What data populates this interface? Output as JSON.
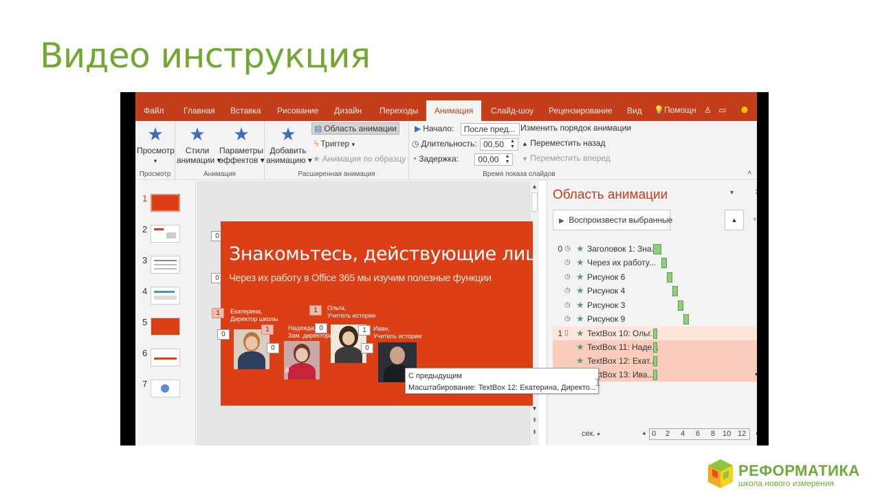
{
  "page_title": "Видео инструкция",
  "ribbon_tabs": [
    "Файл",
    "Главная",
    "Вставка",
    "Рисование",
    "Дизайн",
    "Переходы",
    "Анимация",
    "Слайд-шоу",
    "Рецензирование",
    "Вид"
  ],
  "active_tab": "Анимация",
  "help_label": "Помощн",
  "ribbon": {
    "preview_label": "Просмотр",
    "styles_label_1": "Стили",
    "styles_label_2": "анимации",
    "effects_label_1": "Параметры",
    "effects_label_2": "эффектов",
    "add_label_1": "Добавить",
    "add_label_2": "анимацию",
    "pane_label": "Область анимации",
    "trigger_label": "Триггер",
    "painter_label": "Анимация по образцу",
    "start_label": "Начало:",
    "start_value": "После пред...",
    "duration_label": "Длительность:",
    "duration_value": "00,50",
    "delay_label": "Задержка:",
    "delay_value": "00,00",
    "reorder_label": "Изменить порядок анимации",
    "move_back_label": "Переместить назад",
    "move_forward_label": "Переместить вперед",
    "group_preview": "Просмотр",
    "group_animation": "Анимация",
    "group_advanced": "Расширенная анимация",
    "group_timing": "Время показа слайдов"
  },
  "thumbnails": [
    "1",
    "2",
    "3",
    "4",
    "5",
    "6",
    "7"
  ],
  "slide": {
    "title": "Знакомьтесь, действующие лица",
    "subtitle": "Через их работу в Office 365 мы изучим полезные функции",
    "tags": {
      "t0": "0",
      "t1": "0",
      "t2": "1",
      "t3": "0",
      "t4": "1",
      "t5": "0",
      "t6": "1",
      "t7": "0",
      "t8": "1",
      "t9": "0"
    },
    "people": [
      {
        "name": "Екатерина,",
        "role": "Директор школы"
      },
      {
        "name": "Надежда,",
        "role": "Зам. директора"
      },
      {
        "name": "Ольга,",
        "role": "Учитель истории"
      },
      {
        "name": "Иван,",
        "role": "Учитель истории"
      }
    ],
    "partial_letter": "й"
  },
  "tooltip": {
    "line1": "С предыдущим",
    "line2": "Масштабирование: TextBox 12: Екатерина, Директо..."
  },
  "anim_pane": {
    "title": "Область анимации",
    "play_label": "Воспроизвести выбранные",
    "rows": [
      {
        "num": "0",
        "label": "Заголовок 1: Зна..."
      },
      {
        "num": "",
        "label": "Через их работу..."
      },
      {
        "num": "",
        "label": "Рисунок 6"
      },
      {
        "num": "",
        "label": "Рисунок 4"
      },
      {
        "num": "",
        "label": "Рисунок 3"
      },
      {
        "num": "",
        "label": "Рисунок 9"
      },
      {
        "num": "1",
        "label": "TextBox 10: Ольг..."
      },
      {
        "num": "",
        "label": "TextBox 11: Наде..."
      },
      {
        "num": "",
        "label": "TextBox 12: Екат..."
      },
      {
        "num": "",
        "label": "TextBox 13: Ива..."
      }
    ],
    "timeline_unit": "сек.",
    "timeline_ticks": [
      "0",
      "2",
      "4",
      "6",
      "8",
      "10",
      "12"
    ]
  },
  "logo": {
    "name": "РЕФОРМАТИКА",
    "subtitle": "школа нового измерения"
  },
  "colors": {
    "title_green": "#70a830",
    "office_red": "#c43e1c",
    "slide_red": "#dc3e15"
  }
}
